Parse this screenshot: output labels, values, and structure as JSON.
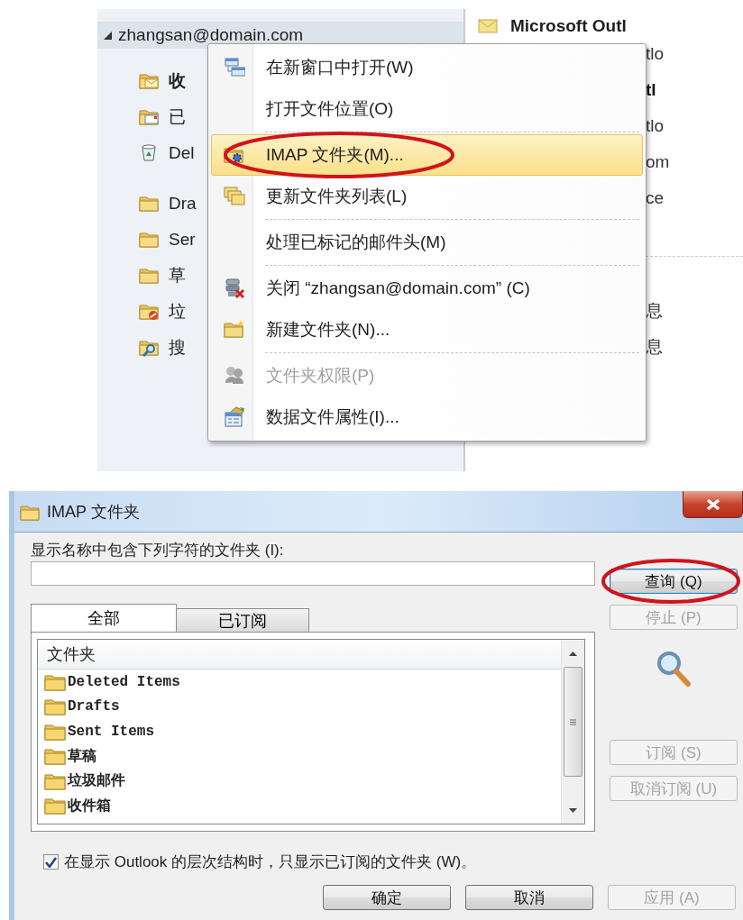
{
  "navigation": {
    "account": {
      "label": "zhangsan@domain.com",
      "expanded": true
    },
    "groups": [
      [
        {
          "label": "收",
          "kind": "inbox",
          "bold": true
        },
        {
          "label": "已",
          "kind": "sent",
          "bold": false
        },
        {
          "label": "Del",
          "kind": "trash",
          "bold": false
        }
      ],
      [
        {
          "label": "Dra",
          "kind": "folder",
          "bold": false
        },
        {
          "label": "Ser",
          "kind": "folder",
          "bold": false
        },
        {
          "label": "草",
          "kind": "folder",
          "bold": false
        },
        {
          "label": "垃",
          "kind": "junk",
          "bold": false
        },
        {
          "label": "搜",
          "kind": "search",
          "bold": false
        }
      ]
    ]
  },
  "message_list": {
    "sender": "Microsoft Outl",
    "rows_top": [
      {
        "text": "tlo",
        "bold": false
      },
      {
        "text": "tl",
        "bold": true
      },
      {
        "text": "tlo",
        "bold": false
      },
      {
        "text": "om",
        "bold": false
      },
      {
        "text": "ce",
        "bold": false
      }
    ],
    "rows_bottom": [
      {
        "text": "息",
        "bold": false
      },
      {
        "text": "息",
        "bold": false
      }
    ]
  },
  "context_menu": [
    {
      "label": "在新窗口中打开(W)",
      "kind": "windows",
      "selected": false,
      "disabled": false,
      "circled": false,
      "separator_after": false
    },
    {
      "label": "打开文件位置(O)",
      "kind": "plain",
      "selected": false,
      "disabled": false,
      "circled": false,
      "separator_after": true
    },
    {
      "label": "IMAP 文件夹(M)...",
      "kind": "imap",
      "selected": true,
      "disabled": false,
      "circled": true,
      "separator_after": false
    },
    {
      "label": "更新文件夹列表(L)",
      "kind": "update",
      "selected": false,
      "disabled": false,
      "circled": false,
      "separator_after": true
    },
    {
      "label": "处理已标记的邮件头(M)",
      "kind": "plain",
      "selected": false,
      "disabled": false,
      "circled": false,
      "separator_after": true
    },
    {
      "label": "关闭 “zhangsan@domain.com” (C)",
      "kind": "close",
      "selected": false,
      "disabled": false,
      "circled": false,
      "separator_after": false
    },
    {
      "label": "新建文件夹(N)...",
      "kind": "create",
      "selected": false,
      "disabled": false,
      "circled": false,
      "separator_after": true
    },
    {
      "label": "文件夹权限(P)",
      "kind": "permissions",
      "selected": false,
      "disabled": true,
      "circled": false,
      "separator_after": false
    },
    {
      "label": "数据文件属性(I)...",
      "kind": "properties",
      "selected": false,
      "disabled": false,
      "circled": false,
      "separator_after": false
    }
  ],
  "dialog": {
    "title": "IMAP 文件夹",
    "filter_label": "显示名称中包含下列字符的文件夹 (I):",
    "tabs": [
      {
        "label": "全部",
        "selected": true
      },
      {
        "label": "已订阅",
        "selected": false
      }
    ],
    "list": {
      "header": "文件夹",
      "items": [
        "Deleted Items",
        "Drafts",
        "Sent Items",
        "草稿",
        "垃圾邮件",
        "收件箱"
      ]
    },
    "search_buttons": [
      {
        "label": "查询 (Q)",
        "disabled": false,
        "circled": true
      },
      {
        "label": "停止 (P)",
        "disabled": true,
        "circled": false
      }
    ],
    "subscription_buttons": [
      {
        "label": "订阅 (S)",
        "disabled": true,
        "circled": false
      },
      {
        "label": "取消订阅 (U)",
        "disabled": true,
        "circled": false
      }
    ],
    "option": {
      "label": "在显示 Outlook 的层次结构时，只显示已订阅的文件夹 (W)。",
      "checked": true
    },
    "footer_buttons": [
      {
        "label": "确定",
        "disabled": false,
        "circled": false
      },
      {
        "label": "取消",
        "disabled": false,
        "circled": false
      },
      {
        "label": "应用 (A)",
        "disabled": true,
        "circled": false
      }
    ]
  }
}
